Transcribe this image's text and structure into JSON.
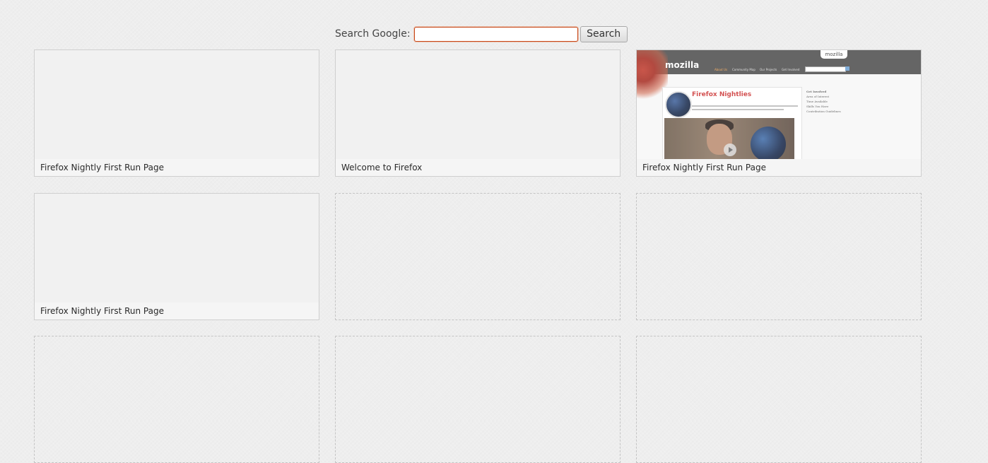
{
  "search": {
    "label": "Search Google:",
    "input_value": "",
    "button_label": "Search"
  },
  "tiles": [
    {
      "title": "Firefox Nightly First Run Page",
      "state": "filled"
    },
    {
      "title": "Welcome to Firefox",
      "state": "filled"
    },
    {
      "title": "Firefox Nightly First Run Page",
      "state": "filled-thumbnail"
    },
    {
      "title": "Firefox Nightly First Run Page",
      "state": "filled"
    },
    {
      "title": "",
      "state": "empty"
    },
    {
      "title": "",
      "state": "empty"
    },
    {
      "title": "",
      "state": "empty"
    },
    {
      "title": "",
      "state": "empty"
    },
    {
      "title": "",
      "state": "empty"
    }
  ],
  "thumbnail": {
    "logo": "mozilla",
    "tab_label": "mozilla",
    "nav_items": [
      "About Us",
      "Community Map",
      "Our Projects",
      "Get Involved"
    ],
    "heading": "Firefox Nightlies",
    "sidebar_items": [
      "Get Involved",
      "Area of Interest",
      "Time Available",
      "Skills You Have",
      "Contribution Guidelines"
    ]
  },
  "colors": {
    "background": "#eeeeee",
    "input_focus_border": "#c7481a",
    "title_bar": "#f5f5f5",
    "heading_red": "#cc3333"
  }
}
